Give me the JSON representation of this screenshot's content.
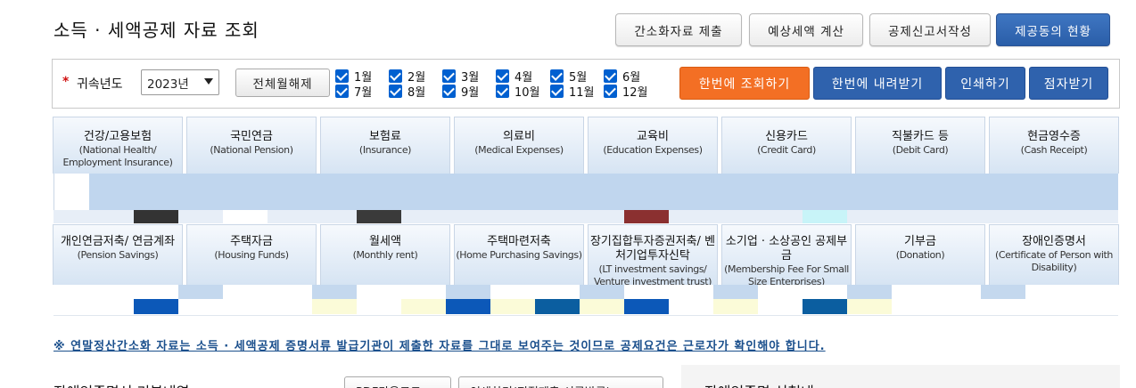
{
  "header": {
    "title": "소득 · 세액공제 자료 조회",
    "buttons": [
      "간소화자료 제출",
      "예상세액 계산",
      "공제신고서작성",
      "제공동의 현황"
    ]
  },
  "filter": {
    "required_mark": "*",
    "year_label": "귀속년도",
    "year_value": "2023년",
    "deselect_all": "전체월해제",
    "months_top": [
      "1월",
      "2월",
      "3월",
      "4월",
      "5월",
      "6월"
    ],
    "months_bottom": [
      "7월",
      "8월",
      "9월",
      "10월",
      "11월",
      "12월"
    ],
    "actions": [
      "한번에 조회하기",
      "한번에 내려받기",
      "인쇄하기",
      "점자받기"
    ]
  },
  "cards_row1": [
    {
      "ko": "건강/고용보험",
      "en": "(National Health/ Employment Insurance)"
    },
    {
      "ko": "국민연금",
      "en": "(National Pension)"
    },
    {
      "ko": "보험료",
      "en": "(Insurance)"
    },
    {
      "ko": "의료비",
      "en": "(Medical Expenses)"
    },
    {
      "ko": "교육비",
      "en": "(Education Expenses)"
    },
    {
      "ko": "신용카드",
      "en": "(Credit Card)"
    },
    {
      "ko": "직불카드 등",
      "en": "(Debit Card)"
    },
    {
      "ko": "현금영수증",
      "en": "(Cash Receipt)"
    }
  ],
  "cards_row2": [
    {
      "ko": "개인연금저축/ 연금계좌",
      "en": "(Pension Savings)"
    },
    {
      "ko": "주택자금",
      "en": "(Housing Funds)"
    },
    {
      "ko": "월세액",
      "en": "(Monthly rent)"
    },
    {
      "ko": "주택마련저축",
      "en": "(Home Purchasing Savings)"
    },
    {
      "ko": "장기집합투자증권저축/ 벤처기업투자신탁",
      "en": "(LT investment savings/ Venture investment trust)"
    },
    {
      "ko": "소기업 · 소상공인 공제부금",
      "en": "(Membership Fee For Small Size Enterprises)"
    },
    {
      "ko": "기부금",
      "en": "(Donation)"
    },
    {
      "ko": "장애인증명서",
      "en": "(Certificate of Person with Disability)"
    }
  ],
  "colors": {
    "primary": "#2f62ad",
    "orange": "#f36f24",
    "checkbox": "#0060d0",
    "link": "#1a4f8c"
  },
  "notice": "※ 연말정산간소화 자료는 소득 · 세액공제 증명서류 발급기관이 제출한 자료를 그대로 보여주는 것이므로 공제요건은 근로자가 확인해야 합니다.",
  "bottom": {
    "title": "장애인증명서 기본내역",
    "buttons": [
      "PDF다운로드",
      "인쇄하기(직접제출 서류발급)"
    ],
    "side_title": "장애인증명 신청내"
  }
}
